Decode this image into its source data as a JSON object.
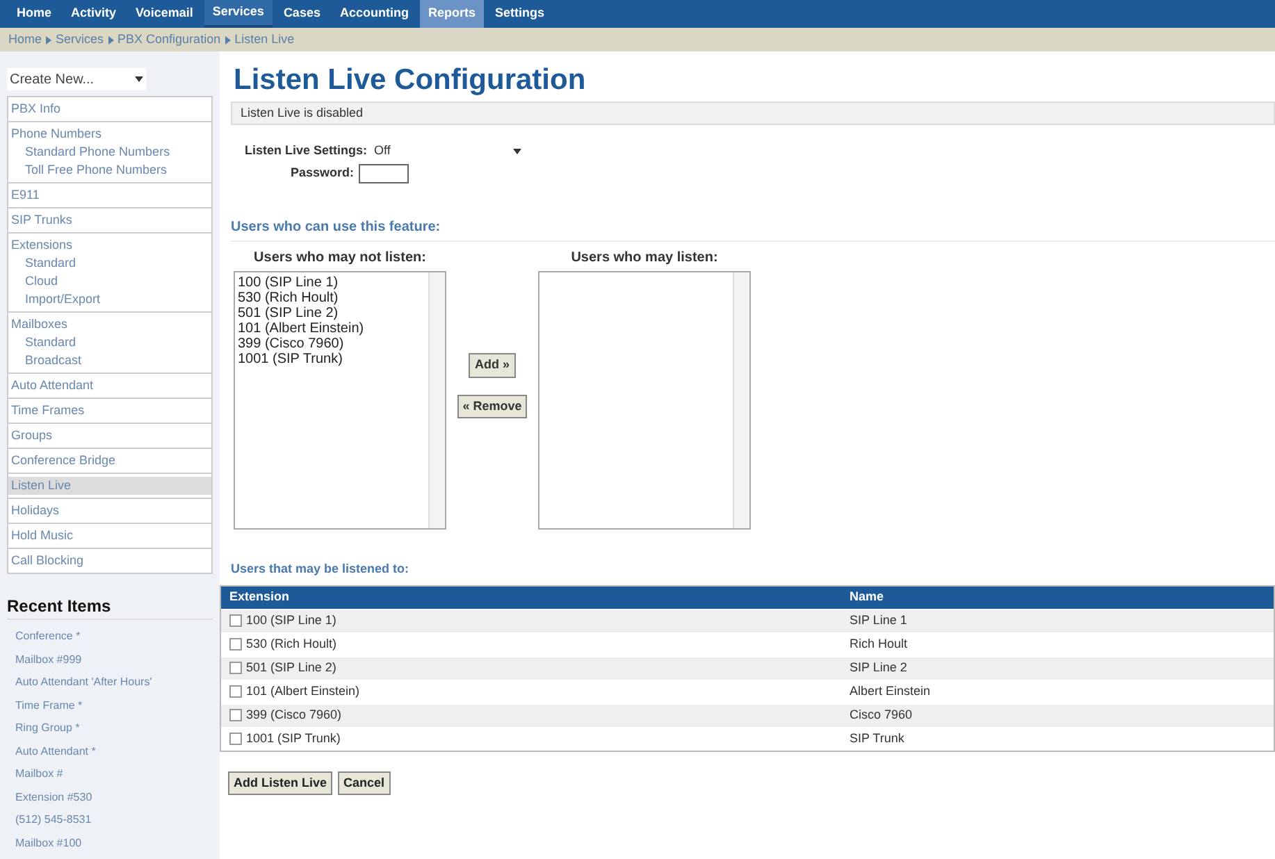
{
  "nav": [
    {
      "label": "Home",
      "selected": false,
      "highlighted": false
    },
    {
      "label": "Activity",
      "selected": false,
      "highlighted": false
    },
    {
      "label": "Voicemail",
      "selected": false,
      "highlighted": false
    },
    {
      "label": "Services",
      "selected": true,
      "highlighted": false
    },
    {
      "label": "Cases",
      "selected": false,
      "highlighted": false
    },
    {
      "label": "Accounting",
      "selected": false,
      "highlighted": false
    },
    {
      "label": "Reports",
      "selected": false,
      "highlighted": true
    },
    {
      "label": "Settings",
      "selected": false,
      "highlighted": false
    }
  ],
  "breadcrumb": [
    "Home",
    "Services",
    "PBX Configuration",
    "Listen Live"
  ],
  "sidebar": {
    "create_select": "Create New...",
    "items": [
      {
        "label": "PBX Info",
        "selected": false
      },
      {
        "label": "Phone Numbers",
        "selected": false,
        "children": [
          {
            "label": "Standard Phone Numbers"
          },
          {
            "label": "Toll Free Phone Numbers"
          }
        ]
      },
      {
        "label": "E911",
        "selected": false
      },
      {
        "label": "SIP Trunks",
        "selected": false
      },
      {
        "label": "Extensions",
        "selected": false,
        "children": [
          {
            "label": "Standard"
          },
          {
            "label": "Cloud"
          },
          {
            "label": "Import/Export"
          }
        ]
      },
      {
        "label": "Mailboxes",
        "selected": false,
        "children": [
          {
            "label": "Standard"
          },
          {
            "label": "Broadcast"
          }
        ]
      },
      {
        "label": "Auto Attendant",
        "selected": false
      },
      {
        "label": "Time Frames",
        "selected": false
      },
      {
        "label": "Groups",
        "selected": false
      },
      {
        "label": "Conference Bridge",
        "selected": false
      },
      {
        "label": "Listen Live",
        "selected": true
      },
      {
        "label": "Holidays",
        "selected": false
      },
      {
        "label": "Hold Music",
        "selected": false
      },
      {
        "label": "Call Blocking",
        "selected": false
      }
    ],
    "recent_title": "Recent Items",
    "recent": [
      "Conference *",
      "Mailbox #999",
      "Auto Attendant 'After Hours'",
      "Time Frame *",
      "Ring Group *",
      "Auto Attendant *",
      "Mailbox #",
      "Extension #530",
      "(512) 545-8531",
      "Mailbox #100"
    ]
  },
  "title": "Listen Live Configuration",
  "status": "Listen Live is disabled",
  "settings": {
    "label": "Listen Live Settings:",
    "value": "Off"
  },
  "password": {
    "label": "Password:"
  },
  "users_heading": "Users who can use this feature:",
  "left_list": {
    "title": "Users who may not listen:",
    "items": [
      "100 (SIP Line 1)",
      "530 (Rich Hoult)",
      "501 (SIP Line 2)",
      "101 (Albert Einstein)",
      "399 (Cisco 7960)",
      "1001 (SIP Trunk)"
    ]
  },
  "right_list": {
    "title": "Users who may listen:"
  },
  "move_buttons": [
    "Add »",
    "« Remove"
  ],
  "table_heading": "Users that may be listened to:",
  "table": {
    "columns": [
      "Extension",
      "Name"
    ],
    "rows": [
      {
        "extension": "100 (SIP Line 1)",
        "name": "SIP Line 1",
        "checked": false
      },
      {
        "extension": "530 (Rich Hoult)",
        "name": "Rich Hoult",
        "checked": false
      },
      {
        "extension": "501 (SIP Line 2)",
        "name": "SIP Line 2",
        "checked": false
      },
      {
        "extension": "101 (Albert Einstein)",
        "name": "Albert Einstein",
        "checked": false
      },
      {
        "extension": "399 (Cisco 7960)",
        "name": "Cisco 7960",
        "checked": false
      },
      {
        "extension": "1001 (SIP Trunk)",
        "name": "SIP Trunk",
        "checked": false
      }
    ]
  },
  "buttons": [
    "Add Listen Live",
    "Cancel"
  ]
}
